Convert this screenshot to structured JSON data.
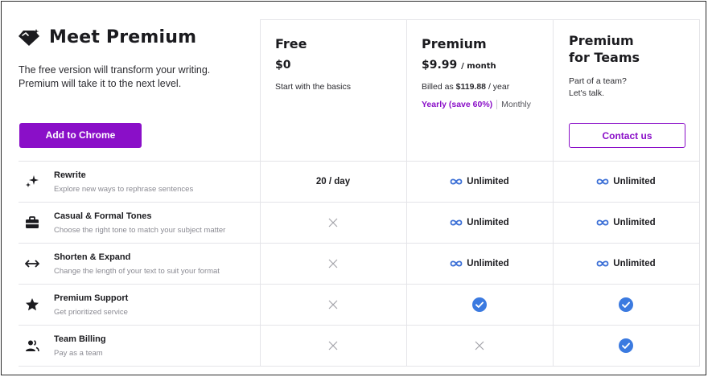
{
  "hero": {
    "title": "Meet Premium",
    "description_line1": "The free version will transform your writing.",
    "description_line2": "Premium will take it to the next level.",
    "add_button": "Add to Chrome"
  },
  "plans": {
    "free": {
      "name": "Free",
      "price": "$0",
      "subtitle": "Start with the basics"
    },
    "premium": {
      "name": "Premium",
      "price": "$9.99",
      "price_unit": "/ month",
      "billed_prefix": "Billed as",
      "billed_amount": "$119.88",
      "billed_suffix": "/ year",
      "toggle_yearly": "Yearly (save 60%)",
      "toggle_monthly": "Monthly"
    },
    "teams": {
      "name_line1": "Premium",
      "name_line2": "for Teams",
      "subtitle_line1": "Part of a team?",
      "subtitle_line2": "Let's talk.",
      "contact_button": "Contact us"
    }
  },
  "features": [
    {
      "name": "Rewrite",
      "description": "Explore new ways to rephrase sentences",
      "icon": "sparkle-icon",
      "free": "20 / day",
      "premium": "Unlimited",
      "teams": "Unlimited"
    },
    {
      "name": "Casual & Formal Tones",
      "description": "Choose the right tone to match your subject matter",
      "icon": "briefcase-icon",
      "free": "x",
      "premium": "Unlimited",
      "teams": "Unlimited"
    },
    {
      "name": "Shorten & Expand",
      "description": "Change the length of your text to suit your format",
      "icon": "arrows-horizontal-icon",
      "free": "x",
      "premium": "Unlimited",
      "teams": "Unlimited"
    },
    {
      "name": "Premium Support",
      "description": "Get prioritized service",
      "icon": "star-icon",
      "free": "x",
      "premium": "check",
      "teams": "check"
    },
    {
      "name": "Team Billing",
      "description": "Pay as a team",
      "icon": "people-icon",
      "free": "x",
      "premium": "x",
      "teams": "check"
    }
  ],
  "colors": {
    "accent": "#8a0fc8",
    "check_blue": "#3b7ae0",
    "infinity_blue": "#3b6fd6",
    "x_gray": "#a4a4aa",
    "grid_line": "#e4e4e8"
  }
}
